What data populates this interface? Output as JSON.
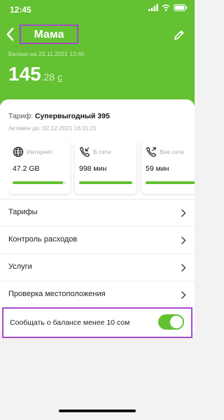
{
  "status_bar": {
    "time": "12:45"
  },
  "header": {
    "title": "Мама",
    "balance_label": "Баланс на 23.11.2021 12:45",
    "balance_int": "145",
    "balance_dec": ".28",
    "balance_currency": "с"
  },
  "tariff": {
    "prefix": "Тариф:",
    "name": "Супервыгодный 395",
    "active_until": "Активен до: 02.12.2021 16:11:21"
  },
  "stats": [
    {
      "label": "Интернет",
      "value": "47.2 GB",
      "icon": "globe-icon",
      "progress": 0.95
    },
    {
      "label": "В сети",
      "value": "998 мин",
      "icon": "phone-incoming-icon",
      "progress": 1.0
    },
    {
      "label": "Вне сети",
      "value": "59 мин",
      "icon": "phone-outgoing-icon",
      "progress": 1.0
    }
  ],
  "menu": [
    {
      "label": "Тарифы"
    },
    {
      "label": "Контроль расходов"
    },
    {
      "label": "Услуги"
    },
    {
      "label": "Проверка местоположения"
    }
  ],
  "notify": {
    "label": "Сообщать о балансе менее 10 сом",
    "enabled": true
  },
  "colors": {
    "brand": "#63c132",
    "highlight": "#a64ac9"
  }
}
